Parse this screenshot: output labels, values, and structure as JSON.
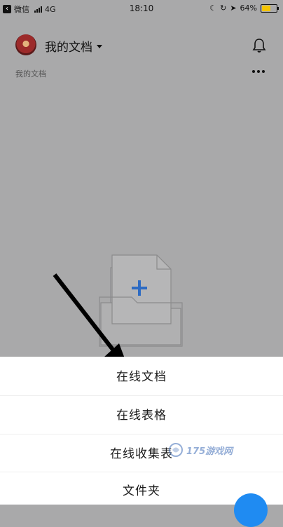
{
  "status_bar": {
    "back_app": "微信",
    "carrier": "4G",
    "time": "18:10",
    "battery": "64%",
    "battery_level": 0.64
  },
  "header": {
    "title": "我的文档",
    "subtitle": "我的文档"
  },
  "menu": {
    "items": [
      "在线文档",
      "在线表格",
      "在线收集表",
      "文件夹"
    ]
  },
  "watermark": {
    "text": "175游戏网"
  },
  "colors": {
    "overlay": "#a9a9aa",
    "accent": "#1f8bf2",
    "plus": "#2d6bc3"
  }
}
